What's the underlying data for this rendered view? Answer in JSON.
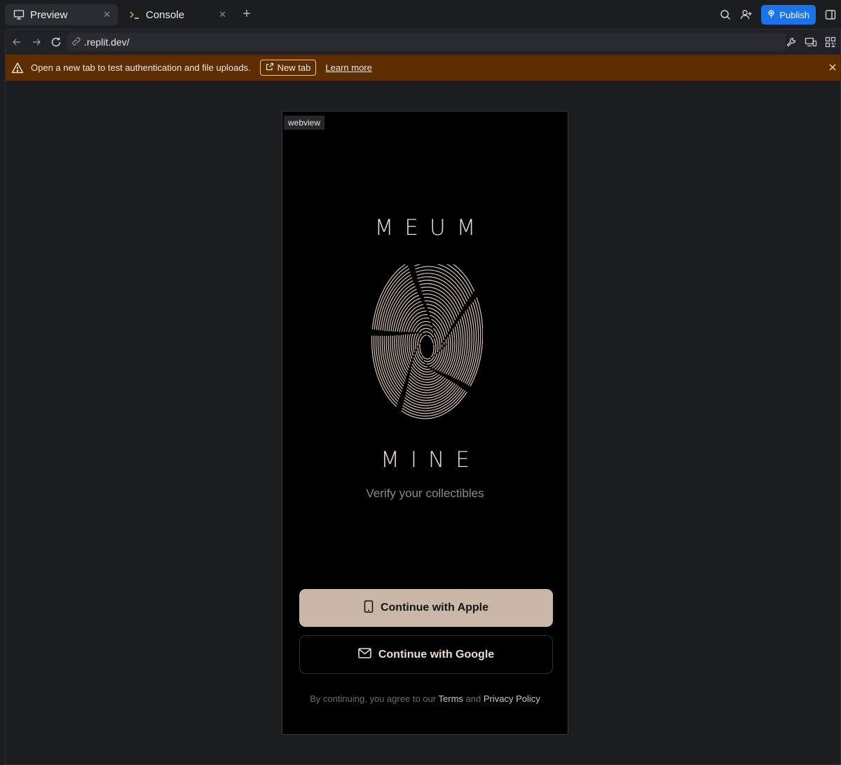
{
  "tabs": [
    {
      "label": "Preview",
      "icon": "monitor-icon",
      "active": true
    },
    {
      "label": "Console",
      "icon": "terminal-icon",
      "active": false
    }
  ],
  "header": {
    "publish_label": "Publish",
    "accent_color": "#1a73e8"
  },
  "address_bar": {
    "url": ".replit.dev/"
  },
  "banner": {
    "message": "Open a new tab to test authentication and file uploads.",
    "new_tab_label": "New tab",
    "learn_more_label": "Learn more",
    "background": "#5c2e02"
  },
  "app": {
    "webview_tag": "webview",
    "brand_top": "MEUM",
    "brand_bottom": "MINE",
    "tagline": "Verify your collectibles",
    "apple_button": "Continue with Apple",
    "google_button": "Continue with Google",
    "legal_prefix": "By continuing, you agree to our",
    "legal_terms": "Terms",
    "legal_and": "and",
    "legal_privacy": "Privacy Policy",
    "accent_color": "#cbb7a8"
  }
}
